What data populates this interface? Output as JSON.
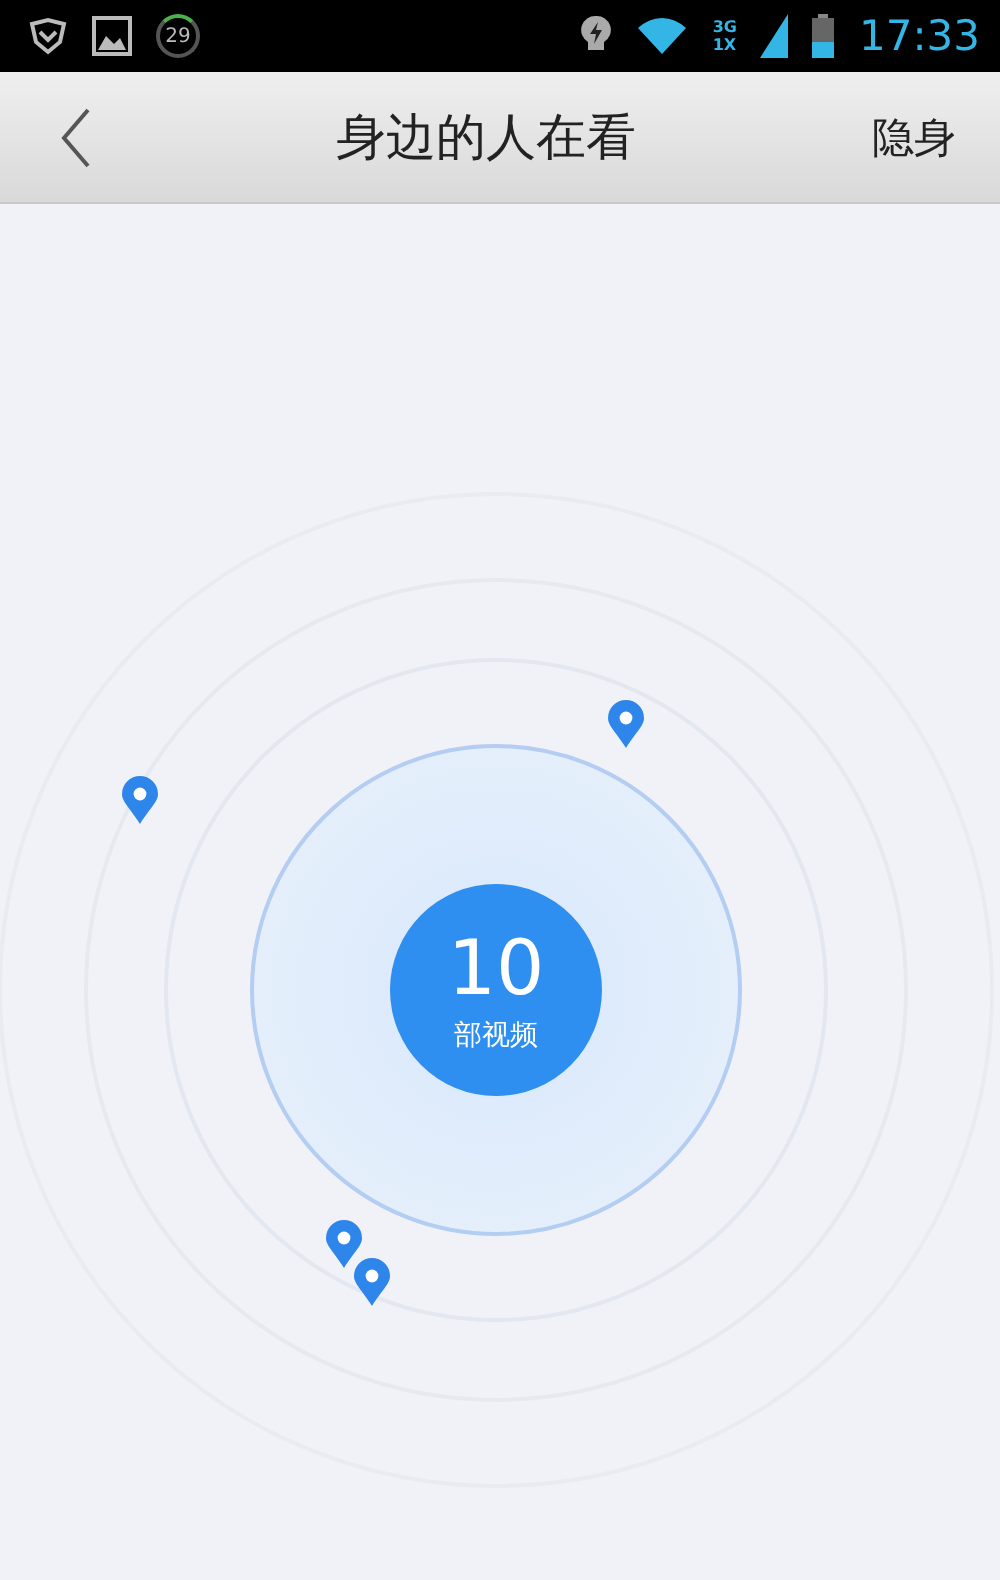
{
  "status_bar": {
    "battery_badge": "29",
    "network_top": "3G",
    "network_bottom": "1X",
    "time": "17:33"
  },
  "header": {
    "title": "身边的人在看",
    "action": "隐身"
  },
  "radar": {
    "count": "10",
    "unit": "部视频"
  }
}
